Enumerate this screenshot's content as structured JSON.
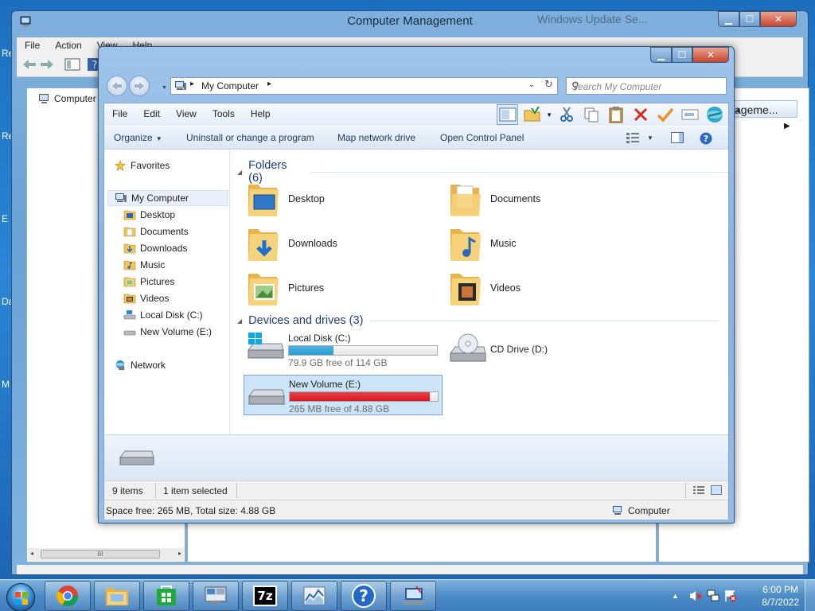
{
  "desktop": {
    "edge_labels": [
      "Re",
      "Re",
      "E",
      "Da",
      "M"
    ]
  },
  "computer_management": {
    "title": "Computer Management",
    "behind_title": "Windows Update Se...",
    "menu": [
      "File",
      "Action",
      "View",
      "Help"
    ],
    "tree_root": "Computer Ma",
    "actions_header": "ageme...",
    "scroll_glyph": "III"
  },
  "explorer": {
    "address": "My Computer",
    "search_placeholder": "Search My Computer",
    "menu": [
      "File",
      "Edit",
      "View",
      "Tools",
      "Help"
    ],
    "commands": {
      "organize": "Organize",
      "uninstall": "Uninstall or change a program",
      "map_drive": "Map network drive",
      "control_panel": "Open Control Panel"
    },
    "nav": {
      "favorites": "Favorites",
      "my_computer": "My Computer",
      "children": [
        "Desktop",
        "Documents",
        "Downloads",
        "Music",
        "Pictures",
        "Videos",
        "Local Disk (C:)",
        "New Volume (E:)"
      ],
      "network": "Network"
    },
    "folders_group": "Folders (6)",
    "folders": [
      "Desktop",
      "Documents",
      "Downloads",
      "Music",
      "Pictures",
      "Videos"
    ],
    "devices_group": "Devices and drives (3)",
    "drives": [
      {
        "name": "Local Disk (C:)",
        "free": "79.9 GB free of 114 GB",
        "used_fraction": 0.3,
        "color": "#26a0da"
      },
      {
        "name": "New Volume (E:)",
        "free": "265 MB free of 4.88 GB",
        "used_fraction": 0.947,
        "color": "#e0161f"
      }
    ],
    "cd_drive": "CD Drive (D:)",
    "status": {
      "items": "9 items",
      "selected": "1 item selected",
      "space": "Space free: 265 MB, Total size: 4.88 GB",
      "location": "Computer"
    }
  },
  "taskbar": {
    "clock_time": "6:00 PM",
    "clock_date": "8/7/2022",
    "apps": [
      "chrome-icon",
      "explorer-icon",
      "store-icon",
      "control-panel-icon",
      "7zip-icon",
      "performance-icon",
      "help-icon",
      "network-icon"
    ],
    "label_7z": "7z",
    "label_help": "?"
  }
}
